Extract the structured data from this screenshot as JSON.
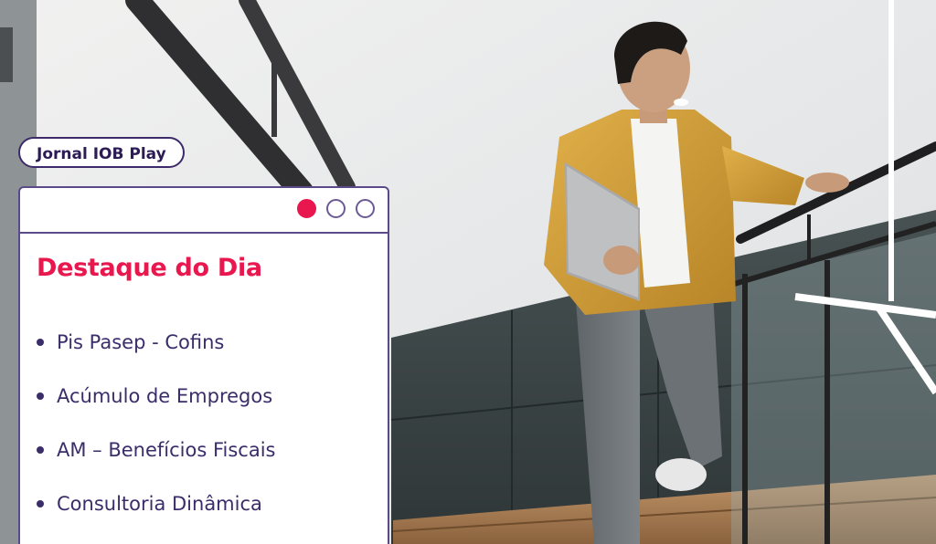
{
  "badge": {
    "label": "Jornal IOB Play"
  },
  "card": {
    "title": "Destaque do Dia",
    "pager": {
      "count": 3,
      "active_index": 0
    },
    "items": [
      {
        "label": "Pis Pasep - Cofins"
      },
      {
        "label": "Acúmulo de Empregos"
      },
      {
        "label": "AM – Benefícios Fiscais"
      },
      {
        "label": "Consultoria Dinâmica"
      }
    ]
  },
  "colors": {
    "accent": "#e8174e",
    "text_primary": "#3a2d6a",
    "border": "#5b4a8a",
    "badge_text": "#2c1b55"
  },
  "background": {
    "icon": "photo-person-walking-upstairs-with-laptop"
  }
}
